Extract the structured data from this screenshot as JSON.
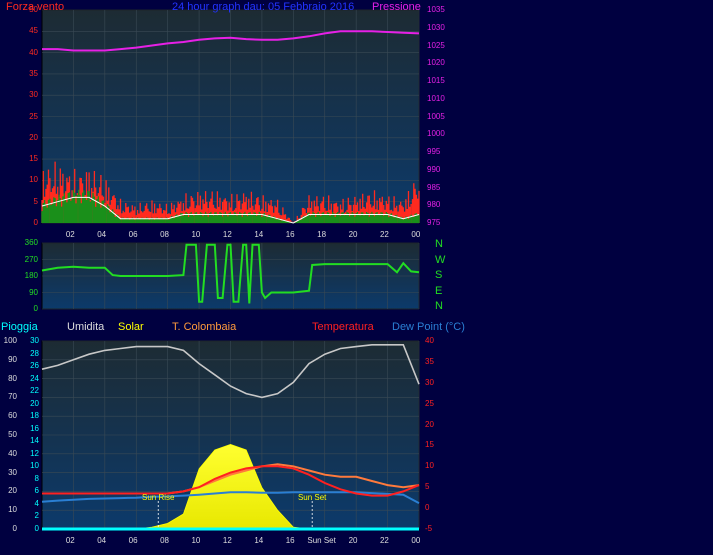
{
  "header": {
    "wind_label": "Forza vento",
    "title": "24 hour graph dau: 05 Febbraio 2016",
    "pressure_label": "Pressione"
  },
  "colors": {
    "background": "#000040",
    "plot_bg_top": "#1d2b33",
    "plot_bg_bottom": "#0c3a6b",
    "wind_gust": "#ff2a1f",
    "wind_avg": "#1a8f1a",
    "wind_avg_line": "#ffffff",
    "pressure": "#e620e6",
    "direction": "#22dd22",
    "humidity": "#c8c8c8",
    "solar": "#ffff00",
    "rain": "#00ffff",
    "temperature": "#ff2020",
    "apparent_temp": "#ff7a3c",
    "dew_point": "#2a7fd4"
  },
  "legend": {
    "rain": "Pioggia",
    "humidity": "Umidita",
    "solar": "Solar",
    "apparent": "T. Colombaia",
    "temperature": "Temperatura",
    "dew_point": "Dew Point (°C)"
  },
  "x_ticks": [
    "02",
    "04",
    "06",
    "08",
    "10",
    "12",
    "14",
    "16",
    "18",
    "20",
    "22",
    "00"
  ],
  "x_ticks_bottom": [
    "02",
    "04",
    "06",
    "08",
    "10",
    "12",
    "14",
    "16",
    "Sun Set",
    "20",
    "22",
    "00"
  ],
  "compass": [
    "N",
    "W",
    "S",
    "E",
    "N"
  ],
  "sun_rise_label": "Sun Rise",
  "sun_set_label": "Sun Set",
  "chart_data": [
    {
      "type": "line",
      "name": "wind_pressure",
      "x_range_hours": [
        0,
        24
      ],
      "wind_axis": {
        "ticks": [
          0,
          5,
          10,
          15,
          20,
          25,
          30,
          35,
          40,
          45,
          50
        ],
        "ylim": [
          0,
          50
        ]
      },
      "pressure_axis": {
        "ticks": [
          975,
          980,
          985,
          990,
          995,
          1000,
          1005,
          1010,
          1015,
          1020,
          1025,
          1030,
          1035
        ],
        "ylim": [
          975,
          1035
        ]
      },
      "series": [
        {
          "name": "Forza vento",
          "axis": "wind",
          "kind": "gust",
          "x": [
            0,
            1,
            2,
            3,
            4,
            5,
            6,
            7,
            8,
            9,
            10,
            11,
            12,
            13,
            14,
            15,
            16,
            17,
            18,
            19,
            20,
            21,
            22,
            23,
            24
          ],
          "y": [
            12,
            13,
            11,
            12,
            10,
            5,
            4,
            5,
            4,
            6,
            7,
            7,
            6,
            7,
            6,
            5,
            0,
            6,
            6,
            5,
            6,
            7,
            6,
            5,
            11
          ]
        },
        {
          "name": "avg",
          "axis": "wind",
          "kind": "avg",
          "x": [
            0,
            1,
            2,
            3,
            4,
            5,
            6,
            7,
            8,
            9,
            10,
            11,
            12,
            13,
            14,
            15,
            16,
            17,
            18,
            19,
            20,
            21,
            22,
            23,
            24
          ],
          "y": [
            4,
            5,
            6,
            6,
            4,
            1,
            1,
            1,
            1,
            2,
            2,
            2,
            2,
            2,
            2,
            1,
            0,
            2,
            2,
            2,
            2,
            2,
            2,
            1,
            2
          ]
        },
        {
          "name": "Pressione",
          "axis": "pressure",
          "x": [
            0,
            1,
            2,
            3,
            4,
            5,
            6,
            7,
            8,
            9,
            10,
            11,
            12,
            13,
            14,
            15,
            16,
            17,
            18,
            19,
            20,
            21,
            22,
            23,
            24
          ],
          "y": [
            1024,
            1024,
            1023.6,
            1023.6,
            1023.6,
            1024,
            1024.4,
            1025,
            1025.6,
            1026,
            1026.6,
            1027,
            1027.2,
            1026.8,
            1026.6,
            1026.6,
            1027,
            1027.6,
            1028.4,
            1029,
            1029,
            1029,
            1028.8,
            1028.6,
            1028.4
          ]
        }
      ]
    },
    {
      "type": "line",
      "name": "wind_direction",
      "x_range_hours": [
        0,
        24
      ],
      "y_ticks": [
        0,
        90,
        180,
        270,
        360
      ],
      "ylim": [
        0,
        360
      ],
      "series": [
        {
          "name": "direction",
          "x": [
            0,
            1,
            2,
            3,
            4,
            4.5,
            5,
            6,
            7,
            8,
            9,
            9.2,
            9.8,
            10,
            10.2,
            10.5,
            11,
            11.2,
            11.5,
            11.8,
            12,
            12.2,
            12.5,
            12.8,
            13,
            13.2,
            13.4,
            13.8,
            14,
            14.2,
            14.6,
            15,
            16,
            17,
            17.2,
            18,
            19,
            20,
            21,
            22,
            22.6,
            23,
            23.5,
            24
          ],
          "y": [
            210,
            225,
            230,
            225,
            225,
            185,
            180,
            180,
            180,
            180,
            185,
            350,
            350,
            40,
            40,
            350,
            350,
            60,
            60,
            350,
            350,
            40,
            40,
            350,
            350,
            30,
            350,
            350,
            90,
            60,
            90,
            90,
            90,
            100,
            240,
            245,
            245,
            245,
            245,
            245,
            200,
            250,
            205,
            200
          ]
        }
      ]
    },
    {
      "type": "line",
      "name": "temperature_humidity",
      "x_range_hours": [
        0,
        24
      ],
      "left_axis": {
        "ticks": [
          0,
          10,
          20,
          30,
          40,
          50,
          60,
          70,
          80,
          90,
          100
        ],
        "ylim": [
          0,
          100
        ]
      },
      "rain_axis": {
        "ticks": [
          0,
          2,
          4,
          6,
          8,
          10,
          12,
          14,
          16,
          18,
          20,
          22,
          24,
          26,
          28,
          30
        ],
        "ylim": [
          0,
          30
        ]
      },
      "temp_axis": {
        "ticks": [
          -5,
          0,
          5,
          10,
          15,
          20,
          25,
          30,
          35,
          40
        ],
        "ylim": [
          -5,
          40
        ]
      },
      "series": [
        {
          "name": "Umidita",
          "axis": "left",
          "x": [
            0,
            1,
            2,
            3,
            4,
            5,
            6,
            7,
            8,
            9,
            10,
            11,
            12,
            13,
            14,
            15,
            16,
            17,
            18,
            19,
            20,
            21,
            22,
            23,
            24
          ],
          "y": [
            85,
            87,
            90,
            93,
            95,
            96,
            97,
            97,
            97,
            95,
            88,
            82,
            76,
            72,
            70,
            72,
            78,
            88,
            93,
            96,
            97,
            98,
            98,
            98,
            77
          ]
        },
        {
          "name": "Solar",
          "axis": "left",
          "x": [
            0,
            6,
            7,
            8,
            9,
            10,
            11,
            12,
            13,
            14,
            15,
            16,
            17,
            24
          ],
          "y": [
            0,
            0,
            1,
            3,
            8,
            32,
            42,
            45,
            42,
            22,
            10,
            1,
            0,
            0
          ]
        },
        {
          "name": "Pioggia",
          "axis": "rain",
          "x": [
            0,
            24
          ],
          "y": [
            0,
            0
          ]
        },
        {
          "name": "Temperatura",
          "axis": "temp",
          "x": [
            0,
            1,
            2,
            3,
            4,
            5,
            6,
            7,
            8,
            9,
            10,
            11,
            12,
            13,
            14,
            15,
            16,
            17,
            18,
            19,
            20,
            21,
            22,
            23,
            24
          ],
          "y": [
            3.5,
            3.5,
            3.5,
            3.5,
            3.5,
            3.5,
            3.5,
            3.5,
            3.5,
            4,
            5,
            7,
            8.5,
            9.5,
            10,
            10,
            9.5,
            8,
            6,
            4.5,
            3.5,
            3,
            3,
            4,
            5.5
          ]
        },
        {
          "name": "T. Colombaia",
          "axis": "temp",
          "x": [
            0,
            1,
            2,
            3,
            4,
            5,
            6,
            7,
            8,
            9,
            10,
            11,
            12,
            13,
            14,
            15,
            16,
            17,
            18,
            19,
            20,
            21,
            22,
            23,
            24
          ],
          "y": [
            3.5,
            3.5,
            3.5,
            3.5,
            3.5,
            3.5,
            3.5,
            3.5,
            3.5,
            4,
            5,
            6.5,
            8,
            9,
            10,
            10.5,
            10,
            9,
            8,
            7.5,
            7.5,
            6.5,
            5.5,
            5,
            5.5
          ]
        },
        {
          "name": "Dew Point (°C)",
          "axis": "temp",
          "x": [
            0,
            1,
            2,
            3,
            4,
            5,
            6,
            7,
            8,
            9,
            10,
            11,
            12,
            13,
            14,
            15,
            16,
            17,
            18,
            19,
            20,
            21,
            22,
            23,
            24
          ],
          "y": [
            1.5,
            1.8,
            2,
            2.2,
            2.3,
            2.4,
            2.5,
            2.7,
            2.8,
            3,
            3.2,
            3.5,
            3.8,
            3.8,
            3.7,
            3.7,
            3.8,
            3.8,
            3.8,
            3.8,
            3.8,
            3.6,
            3.4,
            3.2,
            1.2
          ]
        }
      ]
    }
  ]
}
